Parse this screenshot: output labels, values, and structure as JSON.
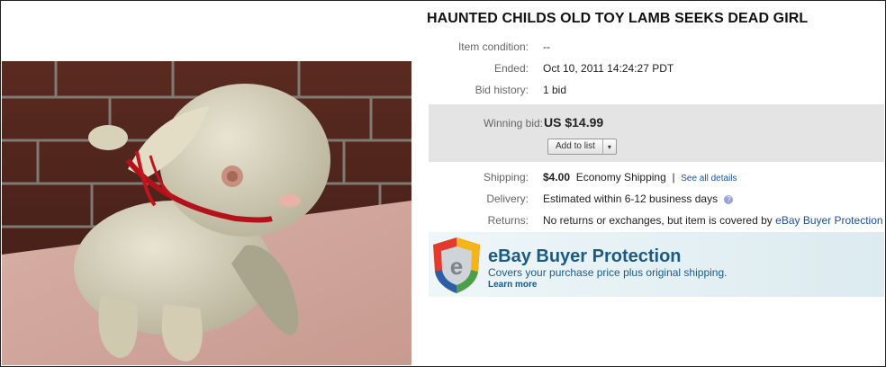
{
  "listing": {
    "title": "HAUNTED CHILDS OLD TOY LAMB SEEKS DEAD GIRL"
  },
  "details": {
    "item_condition_label": "Item condition:",
    "item_condition_value": "--",
    "ended_label": "Ended:",
    "ended_value": "Oct 10, 2011 14:24:27 PDT",
    "bid_history_label": "Bid history:",
    "bid_history_value": "1 bid"
  },
  "bid": {
    "winning_label": "Winning bid:",
    "price": "US $14.99",
    "add_to_list": "Add to list",
    "dropdown_glyph": "▾"
  },
  "shipping": {
    "shipping_label": "Shipping:",
    "shipping_cost": "$4.00",
    "shipping_method": "Economy Shipping",
    "separator": "|",
    "see_all": "See all details",
    "delivery_label": "Delivery:",
    "delivery_value": "Estimated within 6-12 business days",
    "returns_label": "Returns:",
    "returns_value": "No returns or exchanges, but item is covered by",
    "returns_link": "eBay Buyer Protection"
  },
  "protection": {
    "title": "eBay Buyer Protection",
    "subtitle": "Covers your purchase price plus original shipping.",
    "learn_more": "Learn more",
    "shield_letter": "e"
  },
  "colors": {
    "link": "#1b4fa8",
    "promo_text": "#1c5a86",
    "bid_box_bg": "#e4e4e4"
  },
  "icons": {
    "help": "question-circle-icon",
    "dropdown": "chevron-down-icon",
    "shield": "ebay-shield-icon"
  }
}
